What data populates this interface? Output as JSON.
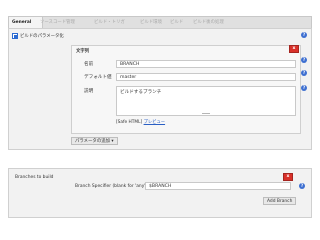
{
  "tabs": [
    {
      "label": "General",
      "active": true
    },
    {
      "label": "ソースコード管理",
      "active": false
    },
    {
      "label": "ビルド・トリガ",
      "active": false
    },
    {
      "label": "ビルド環境",
      "active": false
    },
    {
      "label": "ビルド",
      "active": false
    },
    {
      "label": "ビルド後の処理",
      "active": false
    }
  ],
  "parameterized": {
    "checkbox_label": "ビルドのパラメータ化",
    "checked": true,
    "param_type": "文字列",
    "delete_label": "x",
    "help_label": "?",
    "name_label": "名前",
    "name_value": "BRANCH",
    "default_label": "デフォルト値",
    "default_value": "master",
    "description_label": "説明",
    "description_value": "ビルドするブランチ",
    "safe_html_text": "[Safe HTML]",
    "preview_link": "プレビュー",
    "add_param_button": "パラメータの追加",
    "add_param_caret": "▾"
  },
  "branches": {
    "section_label": "Branches to build",
    "delete_label": "x",
    "help_label": "?",
    "specifier_label": "Branch Specifier (blank for 'any')",
    "specifier_value": "$BRANCH",
    "add_button": "Add Branch"
  },
  "colors": {
    "accent_blue": "#3d6fd1",
    "delete_red": "#d9312a",
    "section_bg": "#f2f2f2",
    "link": "#2a5fc4"
  }
}
